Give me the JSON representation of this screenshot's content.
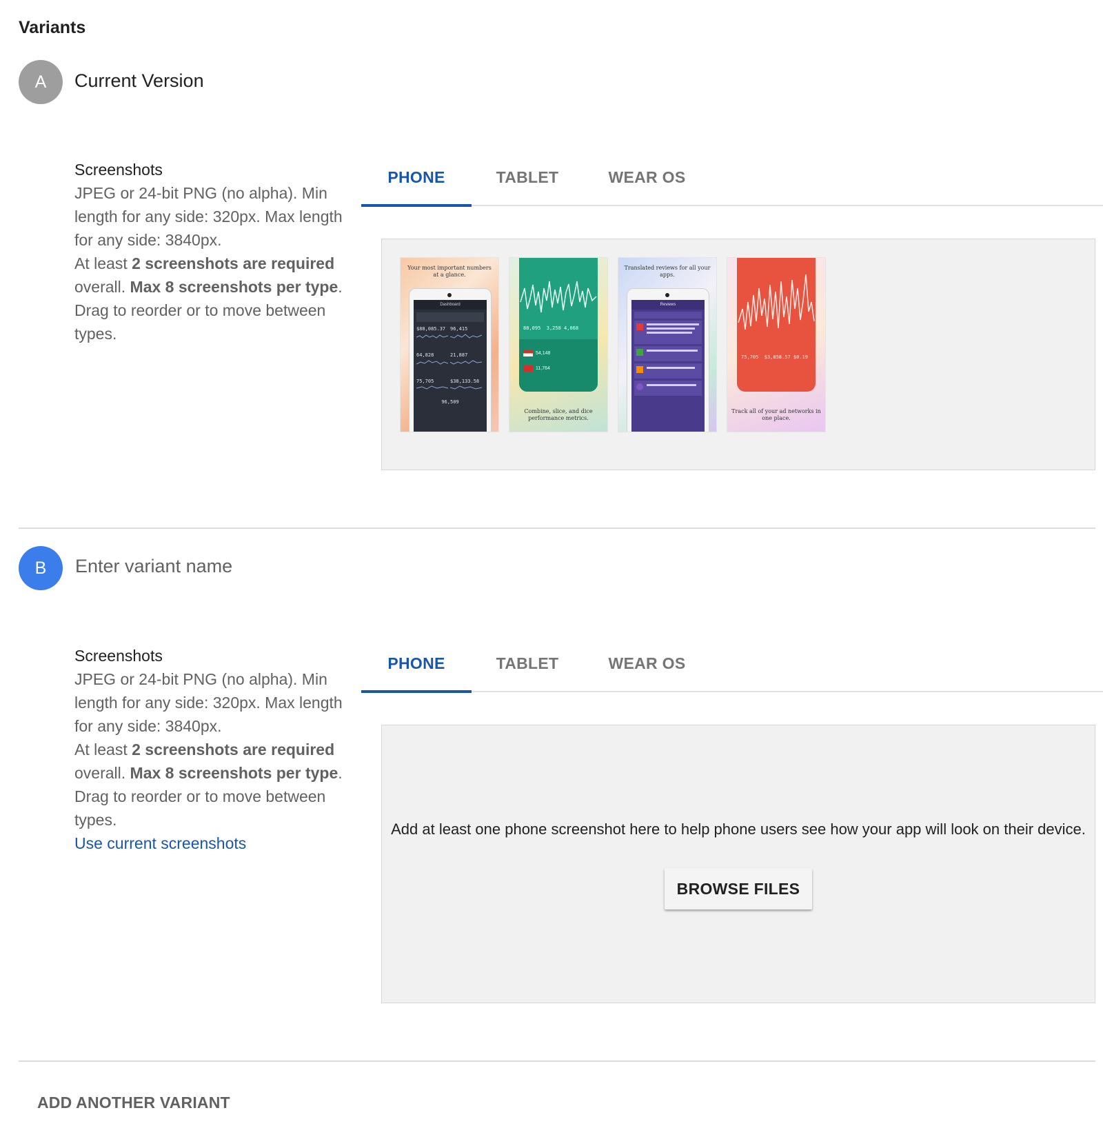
{
  "section_title": "Variants",
  "variants": [
    {
      "badge": "A",
      "name": "Current Version",
      "screenshots": {
        "title": "Screenshots",
        "line1": "JPEG or 24-bit PNG (no alpha). Min length for any side: 320px. Max length for any side: 3840px.",
        "line2_prefix": "At least ",
        "line2_bold1": "2 screenshots are required",
        "line2_mid": " overall. ",
        "line2_bold2": "Max 8 screenshots per type",
        "line2_suffix": ".",
        "line3": "Drag to reorder or to move between types."
      },
      "tabs": [
        "PHONE",
        "TABLET",
        "WEAR OS"
      ],
      "active_tab": "PHONE",
      "thumbnails": [
        {
          "caption": "Your most important numbers at a glance.",
          "theme": "dark-dashboard",
          "phone_title": "Dashboard",
          "stats": [
            "$88,085.37",
            "96,415",
            "64,828",
            "21,887",
            "75,705",
            "$38,133.58",
            "96,509"
          ]
        },
        {
          "caption": "Combine, slice, and dice performance metrics.",
          "theme": "teal-chart",
          "stats": [
            "88,095",
            "3,258",
            "4,068",
            "54,148",
            "11,764"
          ]
        },
        {
          "caption": "Translated reviews for all your apps.",
          "theme": "purple-reviews",
          "phone_title": "Reviews"
        },
        {
          "caption": "Track all of your ad networks in one place.",
          "theme": "red-chart",
          "stats": [
            "75,705",
            "$3,858.57",
            "$0.19"
          ]
        }
      ]
    },
    {
      "badge": "B",
      "name_placeholder": "Enter variant name",
      "screenshots": {
        "title": "Screenshots",
        "line1": "JPEG or 24-bit PNG (no alpha). Min length for any side: 320px. Max length for any side: 3840px.",
        "line2_prefix": "At least ",
        "line2_bold1": "2 screenshots are required",
        "line2_mid": " overall. ",
        "line2_bold2": "Max 8 screenshots per type",
        "line2_suffix": ".",
        "line3": "Drag to reorder or to move between types.",
        "use_current_link": "Use current screenshots"
      },
      "tabs": [
        "PHONE",
        "TABLET",
        "WEAR OS"
      ],
      "active_tab": "PHONE",
      "empty_message": "Add at least one phone screenshot here to help phone users see how your app will look on their device.",
      "browse_button": "BROWSE FILES"
    }
  ],
  "add_variant_label": "ADD ANOTHER VARIANT",
  "colors": {
    "accent_blue": "#1a56a8",
    "badge_a": "#9e9e9e",
    "badge_b": "#3b7dea",
    "panel_bg": "#f1f1f1"
  }
}
